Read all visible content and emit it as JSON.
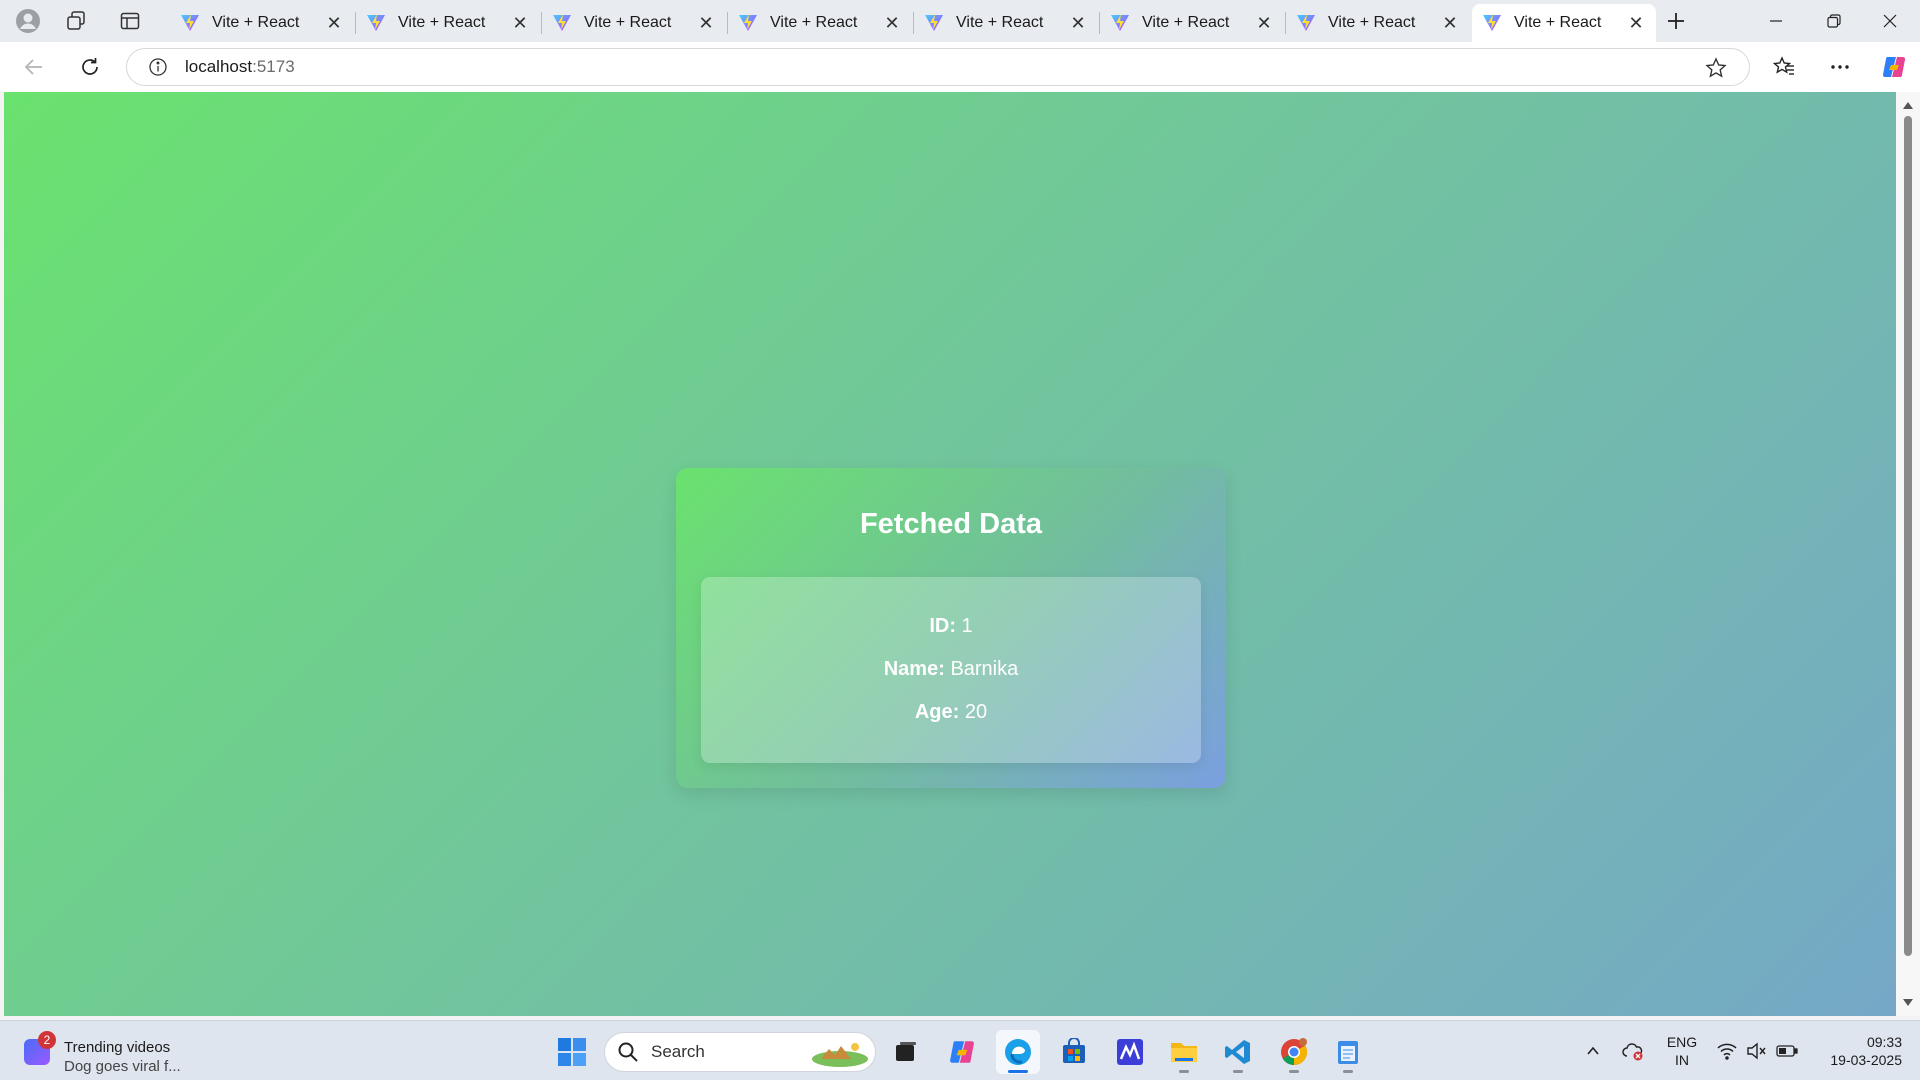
{
  "browser": {
    "tabs": [
      {
        "title": "Vite + React",
        "close": "✕"
      },
      {
        "title": "Vite + React",
        "close": "✕"
      },
      {
        "title": "Vite + React",
        "close": "✕"
      },
      {
        "title": "Vite + React",
        "close": "✕"
      },
      {
        "title": "Vite + React",
        "close": "✕"
      },
      {
        "title": "Vite + React",
        "close": "✕"
      },
      {
        "title": "Vite + React",
        "close": "✕"
      },
      {
        "title": "Vite + React",
        "close": "✕"
      }
    ],
    "active_tab": 7,
    "new_tab_icon": "plus-icon",
    "url_host": "localhost",
    "url_port": ":5173"
  },
  "page": {
    "heading": "Fetched Data",
    "fields": [
      {
        "label": "ID:",
        "value": "1"
      },
      {
        "label": "Name:",
        "value": "Barnika"
      },
      {
        "label": "Age:",
        "value": "20"
      }
    ]
  },
  "taskbar": {
    "news_badge": "2",
    "news_title": "Trending videos",
    "news_subtitle": "Dog goes viral f...",
    "search_label": "Search",
    "lang_line1": "ENG",
    "lang_line2": "IN",
    "time": "09:33",
    "date": "19-03-2025"
  },
  "colors": {
    "page_gradient_start": "#6ae26e",
    "page_gradient_end": "#75a8c7",
    "card_text": "#ffffff"
  }
}
